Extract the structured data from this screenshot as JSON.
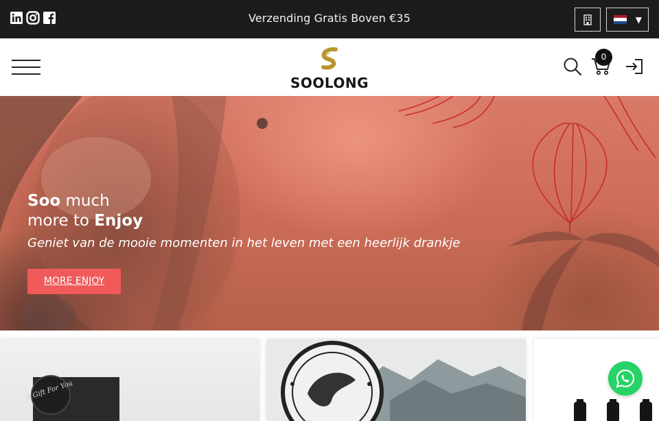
{
  "topbar": {
    "promo_text": "Verzending Gratis Boven €35",
    "social": [
      "linkedin-icon",
      "instagram-icon",
      "facebook-icon"
    ],
    "store_icon": "building-icon",
    "language": {
      "flag": "netherlands-flag",
      "flag_colors": [
        "#ae1c28",
        "#ffffff",
        "#21468b"
      ]
    }
  },
  "header": {
    "logo_text": "SOOLONG",
    "cart_count": "0",
    "icons": [
      "menu-icon",
      "search-icon",
      "cart-icon",
      "login-icon"
    ]
  },
  "hero": {
    "title_bold_1": "Soo",
    "title_rest_1": " much",
    "title_rest_2": "more to ",
    "title_bold_2": "Enjoy",
    "subtitle": "Geniet van de mooie momenten in het leven met een heerlijk drankje",
    "button_label": "MORE ENJOY"
  },
  "cards": {
    "card1_text": "A Gift For You"
  },
  "colors": {
    "topbar_bg": "#1c1c1c",
    "accent_button": "#f05a5a",
    "logo_gold": "#b8962e",
    "whatsapp": "#25d366"
  }
}
